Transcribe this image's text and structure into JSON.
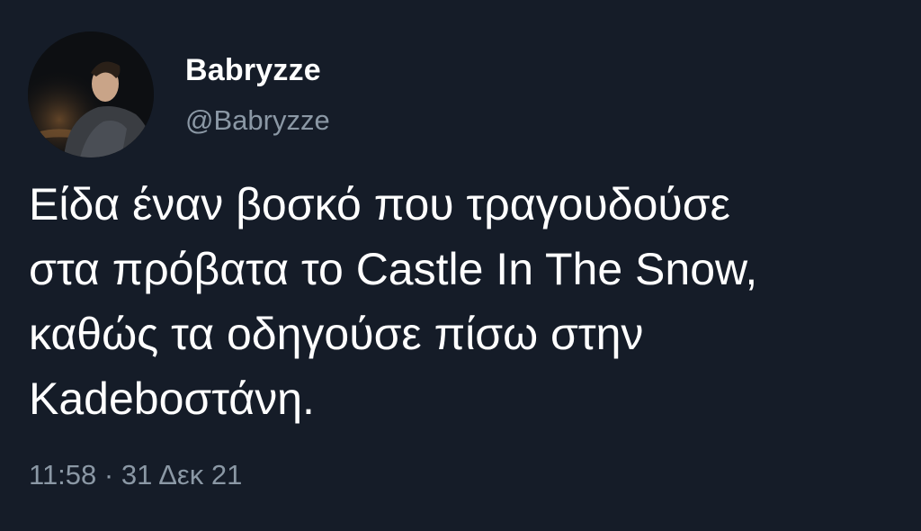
{
  "tweet": {
    "author": {
      "display_name": "Babryzze",
      "handle": "@Babryzze"
    },
    "text": "Είδα έναν βοσκό που τραγουδούσε\nστα πρόβατα το Castle In The Snow,\nκαθώς τα οδηγούσε πίσω στην\nKadeboστάνη.",
    "timestamp": "11:58 · 31 Δεκ 21"
  },
  "colors": {
    "background": "#151c28",
    "primary_text": "#ffffff",
    "secondary_text": "#8b98a5"
  }
}
